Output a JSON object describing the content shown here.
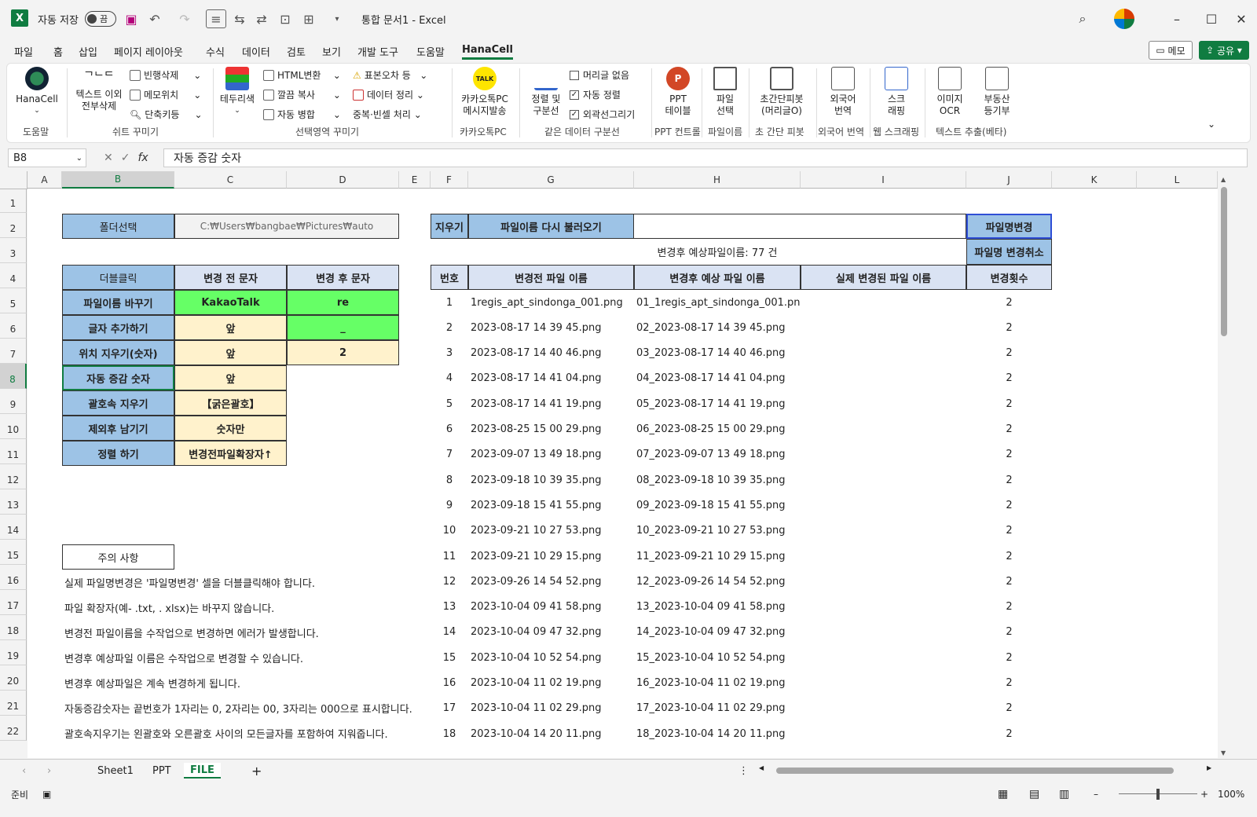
{
  "app": {
    "autosave_label": "자동 저장",
    "autosave_state": "끔",
    "doc_title": "통합 문서1  -  Excel",
    "logo": "X"
  },
  "menu": [
    "파일",
    "홈",
    "삽입",
    "페이지 레이아웃",
    "수식",
    "데이터",
    "검토",
    "보기",
    "개발 도구",
    "도움말",
    "HanaCell"
  ],
  "menu_active": "HanaCell",
  "memo_label": "메모",
  "share_label": "공유",
  "ribbon": {
    "hanacell": "HanaCell",
    "text_except": "텍스트 이외",
    "delete_all": "전부삭제",
    "empty_row_del": "빈행삭제",
    "memo_pos": "메모위치",
    "shortcut": "단축키등",
    "border_color": "테두리색",
    "html_convert": "HTML변환",
    "clean_copy": "깔끔 복사",
    "auto_merge": "자동 병합",
    "std_error": "표본오차 등",
    "data_clean": "데이터 정리",
    "dup_blank": "중복·빈셀 처리",
    "kakao1": "카카오톡PC",
    "kakao2": "메시지발송",
    "sort1": "정렬 및",
    "sort2": "구분선",
    "no_header": "머리글 없음",
    "auto_sort": "자동 정렬",
    "outline": "외곽선그리기",
    "ppt1": "PPT",
    "ppt2": "테이블",
    "file1": "파일",
    "file2": "선택",
    "pivot1": "초간단피봇",
    "pivot2": "(머리글O)",
    "foreign1": "외국어",
    "foreign2": "번역",
    "scrap1": "스크",
    "scrap2": "래핑",
    "ocr1": "이미지",
    "ocr2": "OCR",
    "realty1": "부동산",
    "realty2": "등기부",
    "groups": [
      "도움말",
      "쉬트 꾸미기",
      "선택영역 꾸미기",
      "카카오톡PC",
      "같은 데이터 구분선",
      "PPT 컨트롤",
      "파일이름",
      "초 간단 피봇",
      "외국어 번역",
      "웹 스크래핑",
      "텍스트 추출(베타)"
    ]
  },
  "formula_bar": {
    "name_box": "B8",
    "fx": "fx",
    "content": "자동 증감 숫자"
  },
  "columns": [
    "A",
    "B",
    "C",
    "D",
    "E",
    "F",
    "G",
    "H",
    "I",
    "J",
    "K",
    "L"
  ],
  "rows": [
    "1",
    "2",
    "3",
    "4",
    "5",
    "6",
    "7",
    "8",
    "9",
    "10",
    "11",
    "12",
    "13",
    "14",
    "15",
    "16",
    "17",
    "18",
    "19",
    "20",
    "21",
    "22"
  ],
  "left_panel": {
    "folder_label": "폴더선택",
    "folder_path": "C:₩Users₩bangbae₩Pictures₩auto",
    "hdr_dblclick": "더블클릭",
    "hdr_before": "변경 전 문자",
    "hdr_after": "변경 후 문자",
    "ops": [
      {
        "label": "파일이름 바꾸기",
        "before": "KakaoTalk",
        "after": "re"
      },
      {
        "label": "글자 추가하기",
        "before": "앞",
        "after": "_"
      },
      {
        "label": "위치 지우기(숫자)",
        "before": "앞",
        "after": "2"
      },
      {
        "label": "자동 증감 숫자",
        "before": "앞",
        "after": ""
      },
      {
        "label": "괄호속 지우기",
        "before": "【굵은괄호】",
        "after": ""
      },
      {
        "label": "제외후 남기기",
        "before": "숫자만",
        "after": ""
      },
      {
        "label": "정렬 하기",
        "before": "변경전파일확장자↑",
        "after": ""
      }
    ],
    "notes_title": "주의 사항",
    "notes": [
      "실제 파일명변경은 '파일명변경' 셀을 더블클릭해야 합니다.",
      "파일 확장자(예- .txt, . xlsx)는 바꾸지 않습니다.",
      "변경전 파일이름을 수작업으로 변경하면 에러가 발생합니다.",
      "변경후 예상파일 이름은 수작업으로 변경할 수 있습니다.",
      "변경후 예상파일은 계속 변경하게 됩니다.",
      "자동증감숫자는 끝번호가 1자리는 0, 2자리는 00, 3자리는 000으로 표시합니다.",
      "괄호속지우기는 왼괄호와 오른괄호 사이의 모든글자를 포함하여 지워줍니다."
    ]
  },
  "right_panel": {
    "clear_btn": "지우기",
    "reload_btn": "파일이름 다시 불러오기",
    "rename_btn": "파일명변경",
    "cancel_btn": "파일명 변경취소",
    "expected_count": "변경후 예상파일이름: 77 건",
    "headers": [
      "번호",
      "변경전 파일 이름",
      "변경후 예상 파일 이름",
      "실제 변경된 파일 이름",
      "변경횟수"
    ],
    "rows": [
      [
        "1",
        "1regis_apt_sindonga_001.png",
        "01_1regis_apt_sindonga_001.png",
        "",
        "2"
      ],
      [
        "2",
        "2023-08-17 14 39 45.png",
        "02_2023-08-17 14 39 45.png",
        "",
        "2"
      ],
      [
        "3",
        "2023-08-17 14 40 46.png",
        "03_2023-08-17 14 40 46.png",
        "",
        "2"
      ],
      [
        "4",
        "2023-08-17 14 41 04.png",
        "04_2023-08-17 14 41 04.png",
        "",
        "2"
      ],
      [
        "5",
        "2023-08-17 14 41 19.png",
        "05_2023-08-17 14 41 19.png",
        "",
        "2"
      ],
      [
        "6",
        "2023-08-25 15 00 29.png",
        "06_2023-08-25 15 00 29.png",
        "",
        "2"
      ],
      [
        "7",
        "2023-09-07 13 49 18.png",
        "07_2023-09-07 13 49 18.png",
        "",
        "2"
      ],
      [
        "8",
        "2023-09-18 10 39 35.png",
        "08_2023-09-18 10 39 35.png",
        "",
        "2"
      ],
      [
        "9",
        "2023-09-18 15 41 55.png",
        "09_2023-09-18 15 41 55.png",
        "",
        "2"
      ],
      [
        "10",
        "2023-09-21 10 27 53.png",
        "10_2023-09-21 10 27 53.png",
        "",
        "2"
      ],
      [
        "11",
        "2023-09-21 10 29 15.png",
        "11_2023-09-21 10 29 15.png",
        "",
        "2"
      ],
      [
        "12",
        "2023-09-26 14 54 52.png",
        "12_2023-09-26 14 54 52.png",
        "",
        "2"
      ],
      [
        "13",
        "2023-10-04 09 41 58.png",
        "13_2023-10-04 09 41 58.png",
        "",
        "2"
      ],
      [
        "14",
        "2023-10-04 09 47 32.png",
        "14_2023-10-04 09 47 32.png",
        "",
        "2"
      ],
      [
        "15",
        "2023-10-04 10 52 54.png",
        "15_2023-10-04 10 52 54.png",
        "",
        "2"
      ],
      [
        "16",
        "2023-10-04 11 02 19.png",
        "16_2023-10-04 11 02 19.png",
        "",
        "2"
      ],
      [
        "17",
        "2023-10-04 11 02 29.png",
        "17_2023-10-04 11 02 29.png",
        "",
        "2"
      ],
      [
        "18",
        "2023-10-04 14 20 11.png",
        "18_2023-10-04 14 20 11.png",
        "",
        "2"
      ]
    ]
  },
  "sheet_tabs": [
    "Sheet1",
    "PPT",
    "FILE"
  ],
  "active_tab": "FILE",
  "status": {
    "ready": "준비",
    "zoom": "100%"
  }
}
